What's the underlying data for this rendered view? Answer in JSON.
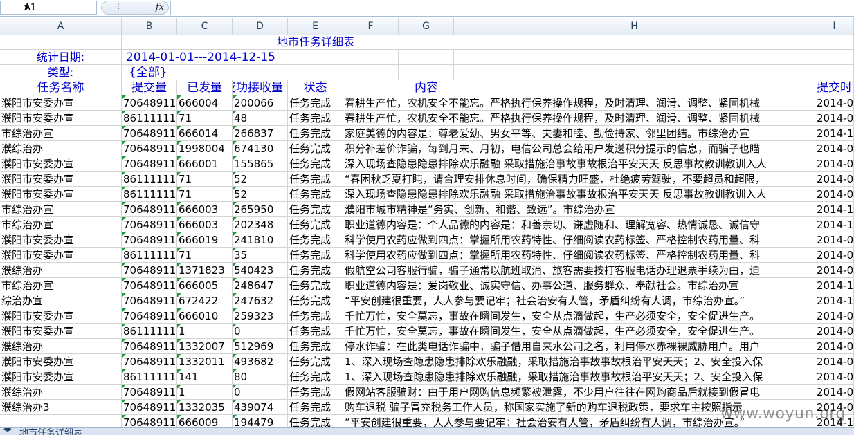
{
  "formula_bar": {
    "cell_ref": "A1",
    "fx_label": "fx",
    "formula": ""
  },
  "columns": [
    "A",
    "B",
    "C",
    "D",
    "E",
    "F",
    "G",
    "H",
    "I"
  ],
  "title": "地市任务详细表",
  "stat_date_label": "统计日期:",
  "stat_date_value": "2014-01-01---2014-12-15",
  "type_label": "类型:",
  "type_value": "{全部}",
  "headers": {
    "name": "任务名称",
    "submitted": "提交量",
    "sent": "已发量",
    "received": "成功接收量",
    "status": "状态",
    "content": "内容",
    "submit_time": "提交时"
  },
  "rows": [
    {
      "name": "濮阳市安委办宣",
      "submitted": "70648911",
      "sent": "666004",
      "received": "200066",
      "status": "任务完成",
      "content": "春耕生产忙，农机安全不能忘。严格执行保养操作规程，及时清理、润滑、调整、紧固机械",
      "time": "2014-0"
    },
    {
      "name": "濮阳市安委办宣",
      "submitted": "86111111",
      "sent": "71",
      "received": "48",
      "status": "任务完成",
      "content": "春耕生产忙，农机安全不能忘。严格执行保养操作规程，及时清理、润滑、调整、紧固机械",
      "time": "2014-0"
    },
    {
      "name": "市综治办宣",
      "submitted": "70648911",
      "sent": "666014",
      "received": "266837",
      "status": "任务完成",
      "content": "家庭美德的内容是：尊老爱幼、男女平等、夫妻和睦、勤俭持家、邻里团结。市综治办宣",
      "time": "2014-1"
    },
    {
      "name": "濮综治办",
      "submitted": "70648911",
      "sent": "1998004",
      "received": "674130",
      "status": "任务完成",
      "content": "积分补差价诈骗，每到月末、月初，电信公司总会给用户发送积分提示的信息，而骗子也瞄",
      "time": "2014-0"
    },
    {
      "name": "濮阳市安委办宣",
      "submitted": "70648911",
      "sent": "666001",
      "received": "155865",
      "status": "任务完成",
      "content": "深入现场查隐患隐患排除欢乐融融 采取措施治事故事故根治平安天天 反思事故教训教训入人",
      "time": "2014-0"
    },
    {
      "name": "濮阳市安委办宣",
      "submitted": "86111111",
      "sent": "71",
      "received": "52",
      "status": "任务完成",
      "content": "“春困秋乏夏打盹，请合理安排休息时间，确保精力旺盛，杜绝疲劳驾驶，不要超员和超限，",
      "time": "2014-0"
    },
    {
      "name": "濮阳市安委办宣",
      "submitted": "86111111",
      "sent": "71",
      "received": "52",
      "status": "任务完成",
      "content": "深入现场查隐患隐患排除欢乐融融 采取措施治事故事故根治平安天天 反思事故教训教训入人",
      "time": "2014-0"
    },
    {
      "name": "市综治办宣",
      "submitted": "70648911",
      "sent": "666003",
      "received": "265950",
      "status": "任务完成",
      "content": "濮阳市城市精神是“务实、创新、和谐、致远”。市综治办宣",
      "time": "2014-1"
    },
    {
      "name": "市综治办宣",
      "submitted": "70648911",
      "sent": "666003",
      "received": "202348",
      "status": "任务完成",
      "content": "职业道德内容是：个人品德的内容是：和善亲切、谦虚随和、理解宽容、热情诚恳、诚信守",
      "time": "2014-1"
    },
    {
      "name": "濮阳市安委办宣",
      "submitted": "70648911",
      "sent": "666019",
      "received": "241810",
      "status": "任务完成",
      "content": "科学使用农药应做到四点：掌握所用农药特性、仔细阅读农药标签、严格控制农药用量、科",
      "time": "2014-0"
    },
    {
      "name": "濮阳市安委办宣",
      "submitted": "86111111",
      "sent": "71",
      "received": "35",
      "status": "任务完成",
      "content": "科学使用农药应做到四点：掌握所用农药特性、仔细阅读农药标签、严格控制农药用量、科",
      "time": "2014-0"
    },
    {
      "name": "濮综治办",
      "submitted": "70648911",
      "sent": "1371823",
      "received": "540423",
      "status": "任务完成",
      "content": "假航空公司客服行骗，骗子通常以航班取消、旅客需要按打客服电话办理退票手续为由，迫",
      "time": "2014-0"
    },
    {
      "name": "市综治办宣",
      "submitted": "70648911",
      "sent": "666005",
      "received": "248647",
      "status": "任务完成",
      "content": "职业道德内容是：爱岗敬业、诚实守信、办事公道、服务群众、奉献社会。市综治办宣",
      "time": "2014-1"
    },
    {
      "name": "综治办宣",
      "submitted": "70648911",
      "sent": "672422",
      "received": "247632",
      "status": "任务完成",
      "content": "“平安创建很重要，人人参与要记牢；社会治安有人管，矛盾纠纷有人调，市综治办宣。”",
      "time": "2014-1"
    },
    {
      "name": "濮阳市安委办宣",
      "submitted": "70648911",
      "sent": "666010",
      "received": "259323",
      "status": "任务完成",
      "content": "千忙万忙，安全莫忘，事故在瞬间发生，安全从点滴做起，生产必须安全，安全促进生产。",
      "time": "2014-0"
    },
    {
      "name": "濮阳市安委办宣",
      "submitted": "86111111",
      "sent": "1",
      "received": "0",
      "status": "任务完成",
      "content": "千忙万忙，安全莫忘，事故在瞬间发生，安全从点滴做起，生产必须安全，安全促进生产。",
      "time": "2014-0"
    },
    {
      "name": "濮综治办",
      "submitted": "70648911",
      "sent": "1332007",
      "received": "512969",
      "status": "任务完成",
      "content": "停水诈骗：在此类电话诈骗中，骗子借用自来水公司之名，利用停水赤裸裸威胁用户。用户",
      "time": "2014-0"
    },
    {
      "name": "濮阳市安委办宣",
      "submitted": "70648911",
      "sent": "1332011",
      "received": "493682",
      "status": "任务完成",
      "content": "1、深入现场查隐患隐患排除欢乐融融，采取措施治事故事故根治平安天天；2、安全投入保",
      "time": "2014-0"
    },
    {
      "name": "濮阳市安委办宣",
      "submitted": "86111111",
      "sent": "141",
      "received": "80",
      "status": "任务完成",
      "content": "1、深入现场查隐患隐患排除欢乐融融，采取措施治事故事故根治平安天天；2、安全投入保",
      "time": "2014-0"
    },
    {
      "name": "濮综治办",
      "submitted": "70648911",
      "sent": "1",
      "received": "0",
      "status": "任务完成",
      "content": "假网站客服骗财：由于用户网购信息频繁被泄露，不少用户往往在网购商品后就接到假冒电",
      "time": "2014-0"
    },
    {
      "name": "濮综治办3",
      "submitted": "70648911",
      "sent": "1332035",
      "received": "439074",
      "status": "任务完成",
      "content": "购车退税 骗子冒充税务工作人员，称国家实施了新的购车退税政策，要求车主按照指示",
      "time": "2014-0"
    },
    {
      "name": "",
      "submitted": "70648911",
      "sent": "666009",
      "received": "194479",
      "status": "任务完成",
      "content": "“平安创建很重要，人人参与要记牢；社会治安有人管，矛盾纠纷有人调，市综治办宣。”",
      "time": "2014-1"
    }
  ],
  "sheet_tab": "地市任务详细表",
  "watermark": "www.woyun.org"
}
